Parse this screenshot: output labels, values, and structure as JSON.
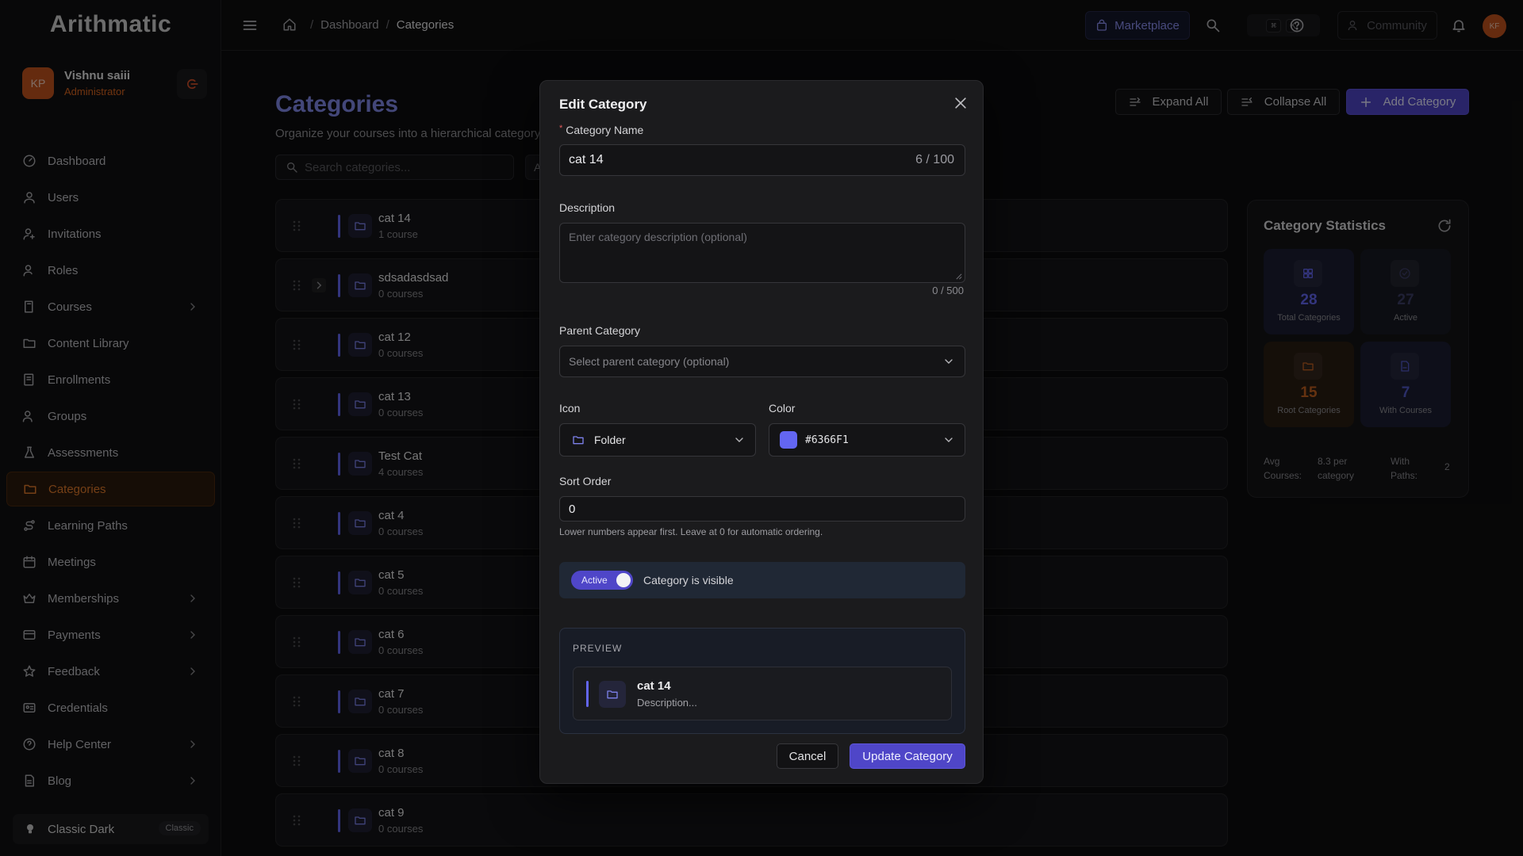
{
  "app": {
    "logo": "Arithmatic"
  },
  "user": {
    "initials": "KP",
    "name": "Vishnu saiii",
    "role": "Administrator"
  },
  "sidebar": {
    "items": [
      {
        "label": "Dashboard",
        "icon": "dashboard-icon",
        "chevron": false,
        "active": false
      },
      {
        "label": "Users",
        "icon": "user-icon",
        "chevron": false,
        "active": false
      },
      {
        "label": "Invitations",
        "icon": "invitation-icon",
        "chevron": false,
        "active": false
      },
      {
        "label": "Roles",
        "icon": "roles-icon",
        "chevron": false,
        "active": false
      },
      {
        "label": "Courses",
        "icon": "book-icon",
        "chevron": true,
        "active": false
      },
      {
        "label": "Content Library",
        "icon": "folder-icon",
        "chevron": false,
        "active": false
      },
      {
        "label": "Enrollments",
        "icon": "enrollment-icon",
        "chevron": false,
        "active": false
      },
      {
        "label": "Groups",
        "icon": "group-icon",
        "chevron": false,
        "active": false
      },
      {
        "label": "Assessments",
        "icon": "flask-icon",
        "chevron": false,
        "active": false
      },
      {
        "label": "Categories",
        "icon": "folder-icon",
        "chevron": false,
        "active": true
      },
      {
        "label": "Learning Paths",
        "icon": "route-icon",
        "chevron": false,
        "active": false
      },
      {
        "label": "Meetings",
        "icon": "calendar-icon",
        "chevron": false,
        "active": false
      },
      {
        "label": "Memberships",
        "icon": "crown-icon",
        "chevron": true,
        "active": false
      },
      {
        "label": "Payments",
        "icon": "card-icon",
        "chevron": true,
        "active": false
      },
      {
        "label": "Feedback",
        "icon": "star-icon",
        "chevron": true,
        "active": false
      },
      {
        "label": "Credentials",
        "icon": "credential-icon",
        "chevron": false,
        "active": false
      },
      {
        "label": "Help Center",
        "icon": "help-icon",
        "chevron": true,
        "active": false
      },
      {
        "label": "Blog",
        "icon": "document-icon",
        "chevron": true,
        "active": false
      }
    ],
    "theme": {
      "label": "Classic Dark",
      "badge": "Classic"
    }
  },
  "topbar": {
    "breadcrumb": [
      "Dashboard",
      "Categories"
    ],
    "marketplace": "Marketplace",
    "shortcut_keys": [
      "⌘",
      "K"
    ],
    "community": "Community",
    "avatar_initials": "KF"
  },
  "page": {
    "title": "Categories",
    "subtitle": "Organize your courses into a hierarchical category s",
    "search_placeholder": "Search categories...",
    "filter_chip": "A",
    "buttons": {
      "expand_all": "Expand All",
      "collapse_all": "Collapse All",
      "add_category": "Add Category"
    }
  },
  "categories": [
    {
      "name": "cat 14",
      "count": "1 course",
      "expandable": false
    },
    {
      "name": "sdsadasdsad",
      "count": "0 courses",
      "expandable": true
    },
    {
      "name": "cat 12",
      "count": "0 courses",
      "expandable": false
    },
    {
      "name": "cat 13",
      "count": "0 courses",
      "expandable": false
    },
    {
      "name": "Test Cat",
      "count": "4 courses",
      "expandable": false
    },
    {
      "name": "cat 4",
      "count": "0 courses",
      "expandable": false
    },
    {
      "name": "cat 5",
      "count": "0 courses",
      "expandable": false
    },
    {
      "name": "cat 6",
      "count": "0 courses",
      "expandable": false
    },
    {
      "name": "cat 7",
      "count": "0 courses",
      "expandable": false
    },
    {
      "name": "cat 8",
      "count": "0 courses",
      "expandable": false
    },
    {
      "name": "cat 9",
      "count": "0 courses",
      "expandable": false
    }
  ],
  "stats": {
    "title": "Category Statistics",
    "tiles": [
      {
        "value": "28",
        "label": "Total Categories",
        "icon": "grid-icon",
        "color": "#6366f1",
        "bg": "#1b1d33"
      },
      {
        "value": "27",
        "label": "Active",
        "icon": "check-circle-icon",
        "color": "#3d3f66",
        "bg": "#181a24"
      },
      {
        "value": "15",
        "label": "Root Categories",
        "icon": "folder-icon",
        "color": "#c2601f",
        "bg": "#2a1d12"
      },
      {
        "value": "7",
        "label": "With Courses",
        "icon": "file-icon",
        "color": "#5158c8",
        "bg": "#1b1d33"
      }
    ],
    "footer": {
      "avg_label": "Avg Courses:",
      "avg_value": "8.3 per category",
      "paths_label": "With Paths:",
      "paths_value": "2"
    }
  },
  "modal": {
    "title": "Edit Category",
    "name_label": "Category Name",
    "name_value": "cat 14",
    "name_counter": "6 / 100",
    "description_label": "Description",
    "description_placeholder": "Enter category description (optional)",
    "description_counter": "0 / 500",
    "parent_label": "Parent Category",
    "parent_placeholder": "Select parent category (optional)",
    "icon_label": "Icon",
    "icon_value": "Folder",
    "color_label": "Color",
    "color_value": "#6366F1",
    "color_swatch": "#6366f1",
    "sort_label": "Sort Order",
    "sort_value": "0",
    "sort_hint": "Lower numbers appear first. Leave at 0 for automatic ordering.",
    "active_toggle": "Active",
    "active_text": "Category is visible",
    "preview_heading": "PREVIEW",
    "preview_name": "cat 14",
    "preview_desc": "Description...",
    "cancel": "Cancel",
    "update": "Update Category"
  }
}
